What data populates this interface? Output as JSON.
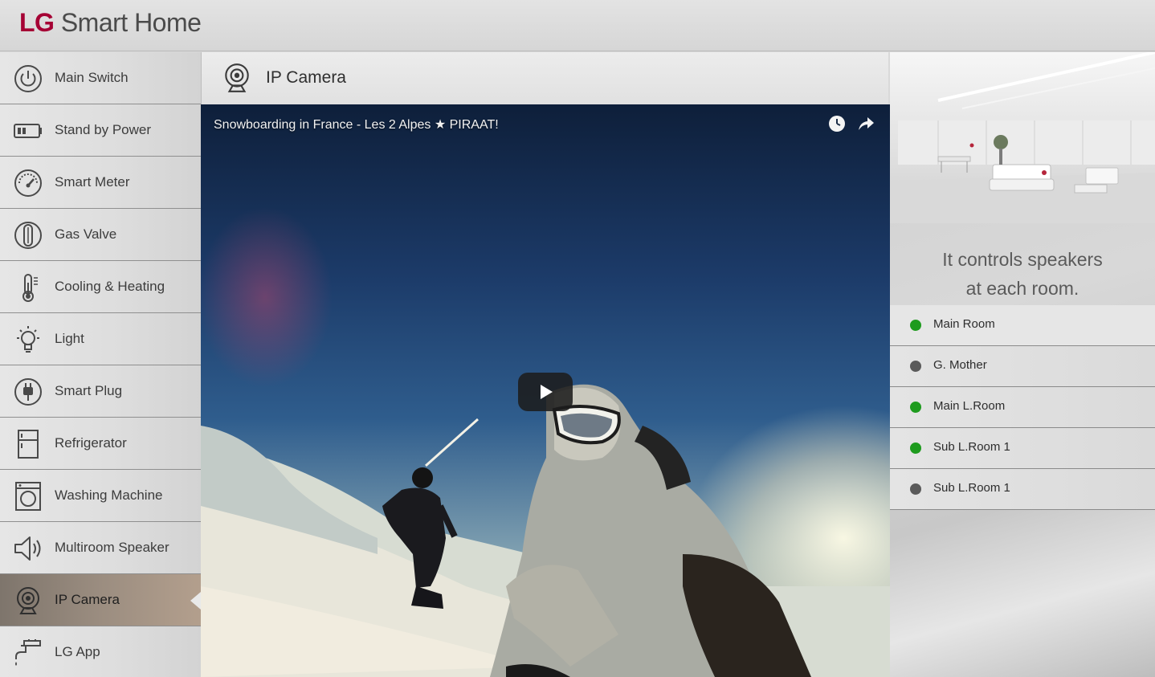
{
  "app": {
    "brand_prefix": "LG",
    "brand_name": "Smart Home"
  },
  "sidebar": {
    "items": [
      {
        "label": "Main Switch",
        "icon": "power-icon"
      },
      {
        "label": "Stand by Power",
        "icon": "battery-icon"
      },
      {
        "label": "Smart Meter",
        "icon": "gauge-icon"
      },
      {
        "label": "Gas Valve",
        "icon": "gas-valve-icon"
      },
      {
        "label": "Cooling & Heating",
        "icon": "thermometer-icon"
      },
      {
        "label": "Light",
        "icon": "bulb-icon"
      },
      {
        "label": "Smart Plug",
        "icon": "plug-icon"
      },
      {
        "label": "Refrigerator",
        "icon": "refrigerator-icon"
      },
      {
        "label": "Washing Machine",
        "icon": "washing-machine-icon"
      },
      {
        "label": "Multiroom Speaker",
        "icon": "speaker-icon"
      },
      {
        "label": "IP Camera",
        "icon": "camera-icon",
        "active": true
      },
      {
        "label": "LG App",
        "icon": "faucet-icon"
      }
    ]
  },
  "main": {
    "title": "IP Camera",
    "title_icon": "camera-icon",
    "video": {
      "title": "Snowboarding in France - Les 2 Alpes ★ PIRAAT!",
      "watch_later_icon": "clock-icon",
      "share_icon": "share-icon",
      "play_icon": "play-icon"
    }
  },
  "speakers": {
    "caption_line1": "It controls speakers",
    "caption_line2": "at each room.",
    "rooms": [
      {
        "label": "Main Room",
        "status": "on"
      },
      {
        "label": "G. Mother",
        "status": "off"
      },
      {
        "label": "Main L.Room",
        "status": "on"
      },
      {
        "label": "Sub L.Room 1",
        "status": "on"
      },
      {
        "label": "Sub L.Room 1",
        "status": "off"
      }
    ]
  },
  "colors": {
    "brand": "#a50034",
    "status_on": "#1e9b1e",
    "status_off": "#5a5a5a",
    "active_item": "#9b8d80"
  }
}
